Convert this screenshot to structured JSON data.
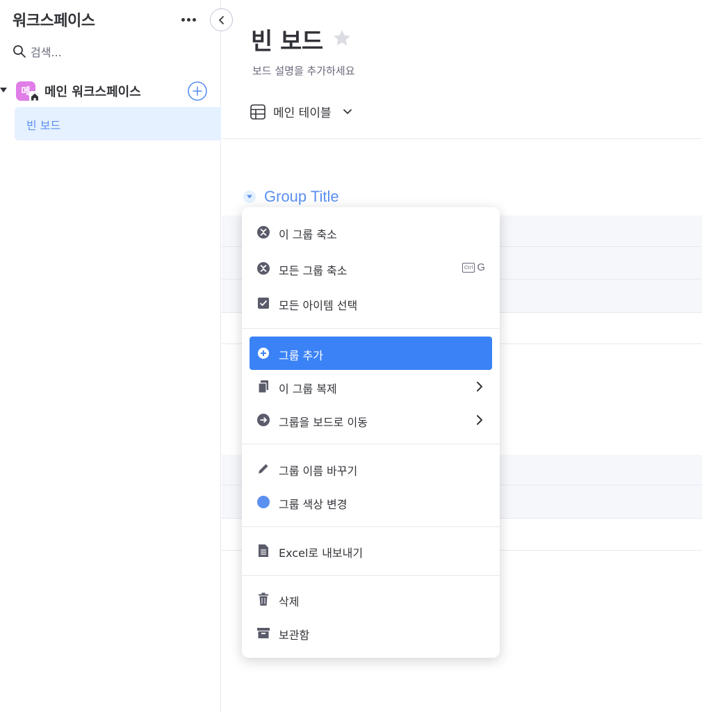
{
  "sidebar": {
    "workspace_title": "워크스페이스",
    "search_placeholder": "검색...",
    "workspace_name": "메인 워크스페이스",
    "workspace_badge": "메",
    "boards": [
      {
        "label": "빈 보드"
      }
    ]
  },
  "board": {
    "title": "빈 보드",
    "description": "보드 설명을 추가하세요",
    "view_label": "메인 테이블",
    "group_title": "Group Title"
  },
  "menu": {
    "items": [
      {
        "label": "이 그룹 축소",
        "icon": "collapse-icon"
      },
      {
        "label": "모든 그룹 축소",
        "icon": "collapse-all-icon",
        "shortcut_key": "Ctrl",
        "shortcut_letter": "G"
      },
      {
        "label": "모든 아이템 선택",
        "icon": "checkbox-icon"
      },
      {
        "label": "그룹 추가",
        "icon": "add-circle-icon"
      },
      {
        "label": "이 그룹 복제",
        "icon": "duplicate-icon"
      },
      {
        "label": "그룹을 보드로 이동",
        "icon": "arrow-right-circle-icon"
      },
      {
        "label": "그룹 이름 바꾸기",
        "icon": "pencil-icon"
      },
      {
        "label": "그룹 색상 변경",
        "icon": "color-dot-icon"
      },
      {
        "label": "Excel로 내보내기",
        "icon": "document-icon"
      },
      {
        "label": "삭제",
        "icon": "trash-icon"
      },
      {
        "label": "보관함",
        "icon": "archive-icon"
      }
    ]
  },
  "colors": {
    "accent": "#3b82f6",
    "group_color": "#5b8ff0",
    "workspace_badge": "#e07ee8"
  }
}
